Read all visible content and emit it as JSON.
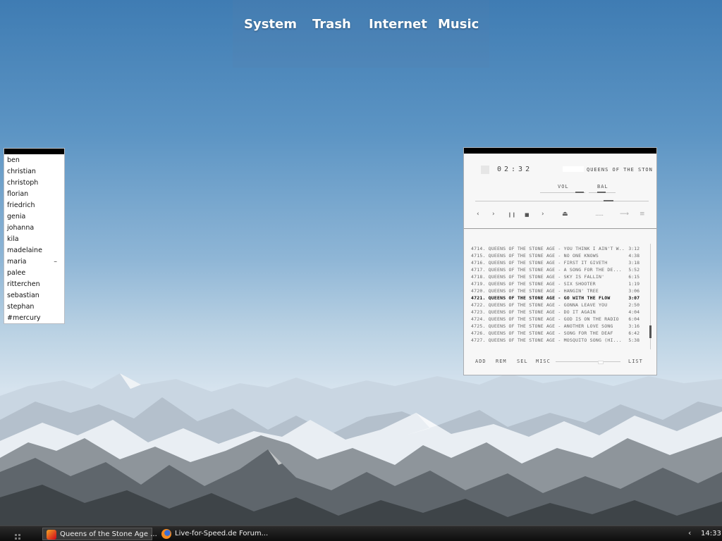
{
  "top_menu": {
    "items": [
      {
        "label": "System"
      },
      {
        "label": "Trash"
      },
      {
        "label": "Internet"
      },
      {
        "label": "Music"
      }
    ]
  },
  "contacts": {
    "items": [
      {
        "name": "ben",
        "mark": ""
      },
      {
        "name": "christian",
        "mark": ""
      },
      {
        "name": "christoph",
        "mark": ""
      },
      {
        "name": "florian",
        "mark": ""
      },
      {
        "name": "friedrich",
        "mark": ""
      },
      {
        "name": "genia",
        "mark": ""
      },
      {
        "name": "johanna",
        "mark": ""
      },
      {
        "name": "kila",
        "mark": ""
      },
      {
        "name": "madelaine",
        "mark": ""
      },
      {
        "name": "maria",
        "mark": "–"
      },
      {
        "name": "palee",
        "mark": ""
      },
      {
        "name": "ritterchen",
        "mark": ""
      },
      {
        "name": "sebastian",
        "mark": ""
      },
      {
        "name": "stephan",
        "mark": ""
      },
      {
        "name": "#mercury",
        "mark": ""
      }
    ]
  },
  "player": {
    "time": "02:32",
    "ticker": "QUEENS OF THE STON",
    "vol_label": "VOL",
    "bal_label": "BAL",
    "controls": {
      "prev": "‹",
      "play": "›",
      "pause": "❙❙",
      "stop": "■",
      "next": "›",
      "eject": "⏏",
      "shuffle": "......",
      "repeat": "⟶",
      "menu": "≡"
    },
    "playlist": [
      {
        "title": "4714. QUEENS OF THE STONE AGE - YOU THINK I AIN'T W...",
        "duration": "3:12",
        "active": false
      },
      {
        "title": "4715. QUEENS OF THE STONE AGE - NO ONE KNOWS",
        "duration": "4:38",
        "active": false
      },
      {
        "title": "4716. QUEENS OF THE STONE AGE - FIRST IT GIVETH",
        "duration": "3:18",
        "active": false
      },
      {
        "title": "4717. QUEENS OF THE STONE AGE - A SONG FOR THE DE...",
        "duration": "5:52",
        "active": false
      },
      {
        "title": "4718. QUEENS OF THE STONE AGE - SKY IS FALLIN'",
        "duration": "6:15",
        "active": false
      },
      {
        "title": "4719. QUEENS OF THE STONE AGE - SIX SHOOTER",
        "duration": "1:19",
        "active": false
      },
      {
        "title": "4720. QUEENS OF THE STONE AGE - HANGIN' TREE",
        "duration": "3:06",
        "active": false
      },
      {
        "title": "4721. QUEENS OF THE STONE AGE - GO WITH THE FLOW",
        "duration": "3:07",
        "active": true
      },
      {
        "title": "4722. QUEENS OF THE STONE AGE - GONNA LEAVE YOU",
        "duration": "2:50",
        "active": false
      },
      {
        "title": "4723. QUEENS OF THE STONE AGE - DO IT AGAIN",
        "duration": "4:04",
        "active": false
      },
      {
        "title": "4724. QUEENS OF THE STONE AGE - GOD IS ON THE RADIO",
        "duration": "6:04",
        "active": false
      },
      {
        "title": "4725. QUEENS OF THE STONE AGE - ANOTHER LOVE SONG",
        "duration": "3:16",
        "active": false
      },
      {
        "title": "4726. QUEENS OF THE STONE AGE - SONG FOR THE DEAF",
        "duration": "6:42",
        "active": false
      },
      {
        "title": "4727. QUEENS OF THE STONE AGE - MOSQUITO SONG (HI...",
        "duration": "5:38",
        "active": false
      }
    ],
    "buttons": {
      "add": "ADD",
      "rem": "REM",
      "sel": "SEL",
      "misc": "MISC",
      "list": "LIST"
    }
  },
  "taskbar": {
    "tasks": [
      {
        "label": "Queens of the Stone Age ...",
        "icon": "winamp-icon",
        "active": true
      },
      {
        "label": "Live-for-Speed.de Forum...",
        "icon": "firefox-icon",
        "active": false
      }
    ],
    "tray_arrow": "‹",
    "clock": "14:33"
  },
  "colors": {
    "panel_bg": "#f7f7f7",
    "titlebar": "#000000",
    "taskbar": "#1a1a1a",
    "menu_text": "#ffffff"
  }
}
